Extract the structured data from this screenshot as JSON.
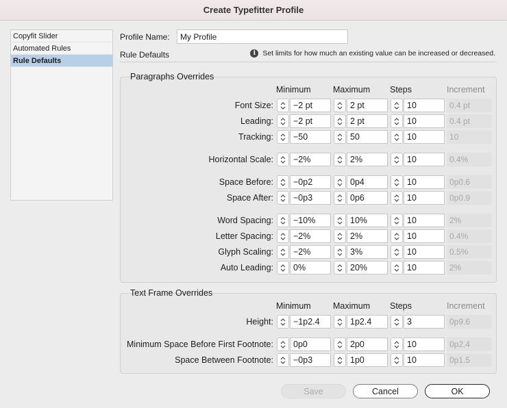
{
  "window": {
    "title": "Create Typefitter Profile"
  },
  "sidebar": {
    "items": [
      {
        "label": "Copyfit Slider"
      },
      {
        "label": "Automated Rules"
      },
      {
        "label": "Rule Defaults"
      }
    ],
    "selected": "Rule Defaults"
  },
  "profile": {
    "name_label": "Profile Name:",
    "name_value": "My Profile"
  },
  "section": {
    "title": "Rule Defaults",
    "info": "Set limits for how much an existing value can be increased or decreased."
  },
  "columns": {
    "minimum": "Minimum",
    "maximum": "Maximum",
    "steps": "Steps",
    "increment": "Increment"
  },
  "paragraphs": {
    "title": "Paragraphs Overrides",
    "rows": [
      {
        "label": "Font Size:",
        "min": "−2 pt",
        "max": "2 pt",
        "steps": "10",
        "inc": "0.4 pt"
      },
      {
        "label": "Leading:",
        "min": "−2 pt",
        "max": "2 pt",
        "steps": "10",
        "inc": "0.4 pt"
      },
      {
        "label": "Tracking:",
        "min": "−50",
        "max": "50",
        "steps": "10",
        "inc": "10"
      },
      {
        "label": "Horizontal Scale:",
        "min": "−2%",
        "max": "2%",
        "steps": "10",
        "inc": "0.4%"
      },
      {
        "label": "Space Before:",
        "min": "−0p2",
        "max": "0p4",
        "steps": "10",
        "inc": "0p0.6"
      },
      {
        "label": "Space After:",
        "min": "−0p3",
        "max": "0p6",
        "steps": "10",
        "inc": "0p0.9"
      },
      {
        "label": "Word Spacing:",
        "min": "−10%",
        "max": "10%",
        "steps": "10",
        "inc": "2%"
      },
      {
        "label": "Letter Spacing:",
        "min": "−2%",
        "max": "2%",
        "steps": "10",
        "inc": "0.4%"
      },
      {
        "label": "Glyph Scaling:",
        "min": "−2%",
        "max": "3%",
        "steps": "10",
        "inc": "0.5%"
      },
      {
        "label": "Auto Leading:",
        "min": "0%",
        "max": "20%",
        "steps": "10",
        "inc": "2%"
      }
    ]
  },
  "textframe": {
    "title": "Text Frame Overrides",
    "rows": [
      {
        "label": "Height:",
        "min": "−1p2.4",
        "max": "1p2.4",
        "steps": "3",
        "inc": "0p9.6"
      },
      {
        "label": "Minimum Space Before First Footnote:",
        "min": "0p0",
        "max": "2p0",
        "steps": "10",
        "inc": "0p2.4"
      },
      {
        "label": "Space Between Footnote:",
        "min": "−0p3",
        "max": "1p0",
        "steps": "10",
        "inc": "0p1.5"
      }
    ]
  },
  "buttons": {
    "save": "Save",
    "cancel": "Cancel",
    "ok": "OK"
  },
  "icons": {
    "info": "info-icon",
    "stepper": "up-down-arrows-icon"
  }
}
